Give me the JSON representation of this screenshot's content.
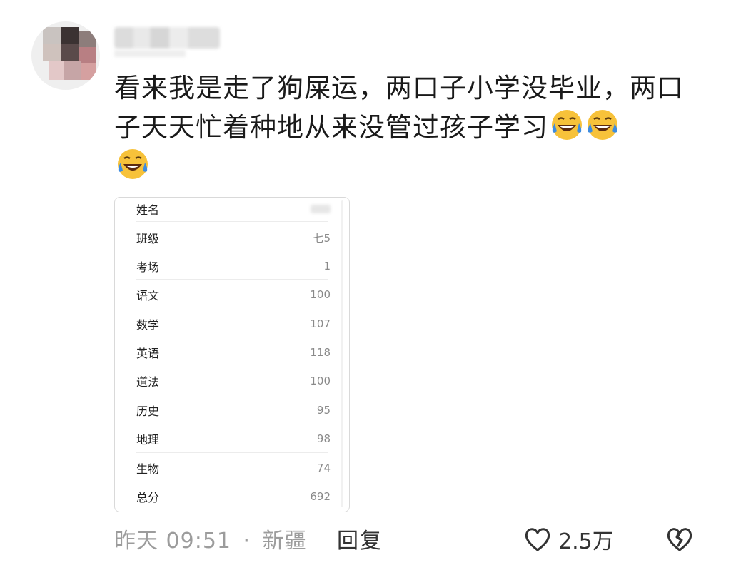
{
  "comment": {
    "text": "看来我是走了狗屎运，两口子小学没毕业，两口子天天忙着种地从来没管过孩子学习",
    "emojis": [
      "laughing-crying-emoji",
      "laughing-crying-emoji",
      "laughing-crying-emoji"
    ]
  },
  "score_card": {
    "rows": [
      {
        "label": "姓名",
        "value": ""
      },
      {
        "label": "班级",
        "value": "七5"
      },
      {
        "label": "考场",
        "value": "1"
      },
      {
        "label": "语文",
        "value": "100"
      },
      {
        "label": "数学",
        "value": "107"
      },
      {
        "label": "英语",
        "value": "118"
      },
      {
        "label": "道法",
        "value": "100"
      },
      {
        "label": "历史",
        "value": "95"
      },
      {
        "label": "地理",
        "value": "98"
      },
      {
        "label": "生物",
        "value": "74"
      },
      {
        "label": "总分",
        "value": "692"
      }
    ]
  },
  "footer": {
    "time": "昨天 09:51",
    "separator": "·",
    "location": "新疆",
    "reply_label": "回复",
    "like_count": "2.5万",
    "like_icon": "heart-outline-icon",
    "dislike_icon": "broken-heart-icon"
  },
  "colors": {
    "text_primary": "#1a1a1a",
    "text_secondary": "#9c9c9c",
    "emoji_yellow": "#F7C23A",
    "emoji_tear": "#3D8CE0"
  }
}
